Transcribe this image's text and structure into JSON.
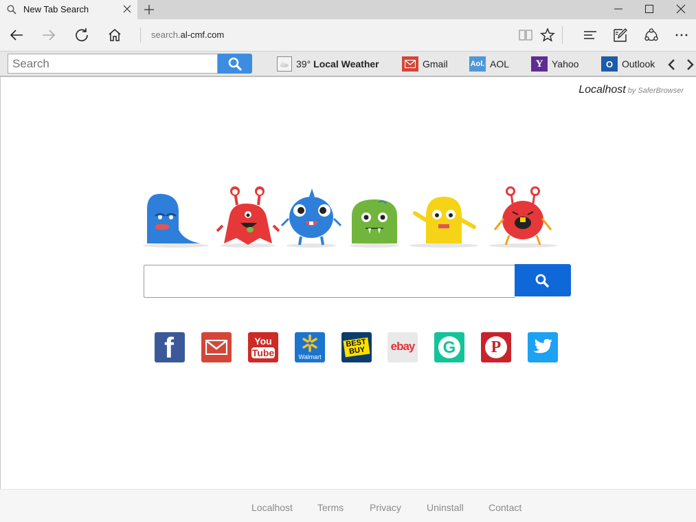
{
  "browser": {
    "tab_title": "New Tab Search",
    "new_tab_symbol": "+",
    "url_prefix": "search.",
    "url_domain": "al-cmf.com"
  },
  "toolbar": {
    "search_placeholder": "Search",
    "weather_temp": "39°",
    "weather_label": "Local Weather",
    "links": [
      {
        "label": "Gmail"
      },
      {
        "label": "AOL",
        "icon_text": "Aol."
      },
      {
        "label": "Yahoo",
        "icon_text": "Y"
      },
      {
        "label": "Outlook",
        "icon_text": "O"
      }
    ]
  },
  "page": {
    "brand_name": "Localhost",
    "brand_by": "by SaferBrowser",
    "quick_links": [
      {
        "name": "facebook",
        "text": "f",
        "color": "#3b5998"
      },
      {
        "name": "gmail",
        "text": "",
        "color": "#d44638"
      },
      {
        "name": "youtube",
        "text": "You",
        "text2": "Tube",
        "color": "#cc2b26"
      },
      {
        "name": "walmart",
        "text": "Walmart",
        "color": "#1a75cf"
      },
      {
        "name": "bestbuy",
        "text": "BEST",
        "text2": "BUY",
        "color": "#0a3d6b"
      },
      {
        "name": "ebay",
        "text": "ebay",
        "color": "#e9e9e9"
      },
      {
        "name": "grammarly",
        "text": "G",
        "color": "#15c39a"
      },
      {
        "name": "pinterest",
        "text": "P",
        "color": "#c8232c"
      },
      {
        "name": "twitter",
        "text": "",
        "color": "#1da1f2"
      }
    ]
  },
  "footer": {
    "links": [
      "Localhost",
      "Terms",
      "Privacy",
      "Uninstall",
      "Contact"
    ]
  },
  "colors": {
    "search_button": "#0f68d8",
    "toolbar_search_button": "#3c8de0"
  }
}
